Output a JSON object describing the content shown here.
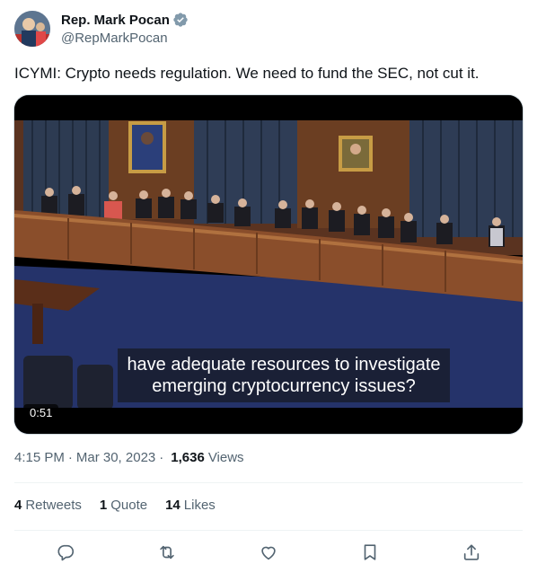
{
  "author": {
    "name": "Rep. Mark Pocan",
    "handle": "@RepMarkPocan",
    "verified_color": "#829aab"
  },
  "tweet": {
    "text": "ICYMI: Crypto needs regulation. We need to fund the SEC, not cut it."
  },
  "video": {
    "caption_line1": "have adequate resources to investigate",
    "caption_line2": "emerging cryptocurrency issues?",
    "duration": "0:51"
  },
  "meta": {
    "time": "4:15 PM",
    "separator": "·",
    "date": "Mar 30, 2023",
    "views_count": "1,636",
    "views_label": "Views"
  },
  "stats": {
    "retweets_count": "4",
    "retweets_label": "Retweets",
    "quotes_count": "1",
    "quotes_label": "Quote",
    "likes_count": "14",
    "likes_label": "Likes"
  },
  "actions": [
    "reply-icon",
    "retweet-icon",
    "like-icon",
    "bookmark-icon",
    "share-icon"
  ],
  "colors": {
    "text_primary": "#0f1419",
    "text_secondary": "#536471",
    "divider": "#eff3f4",
    "icon": "#536471"
  }
}
